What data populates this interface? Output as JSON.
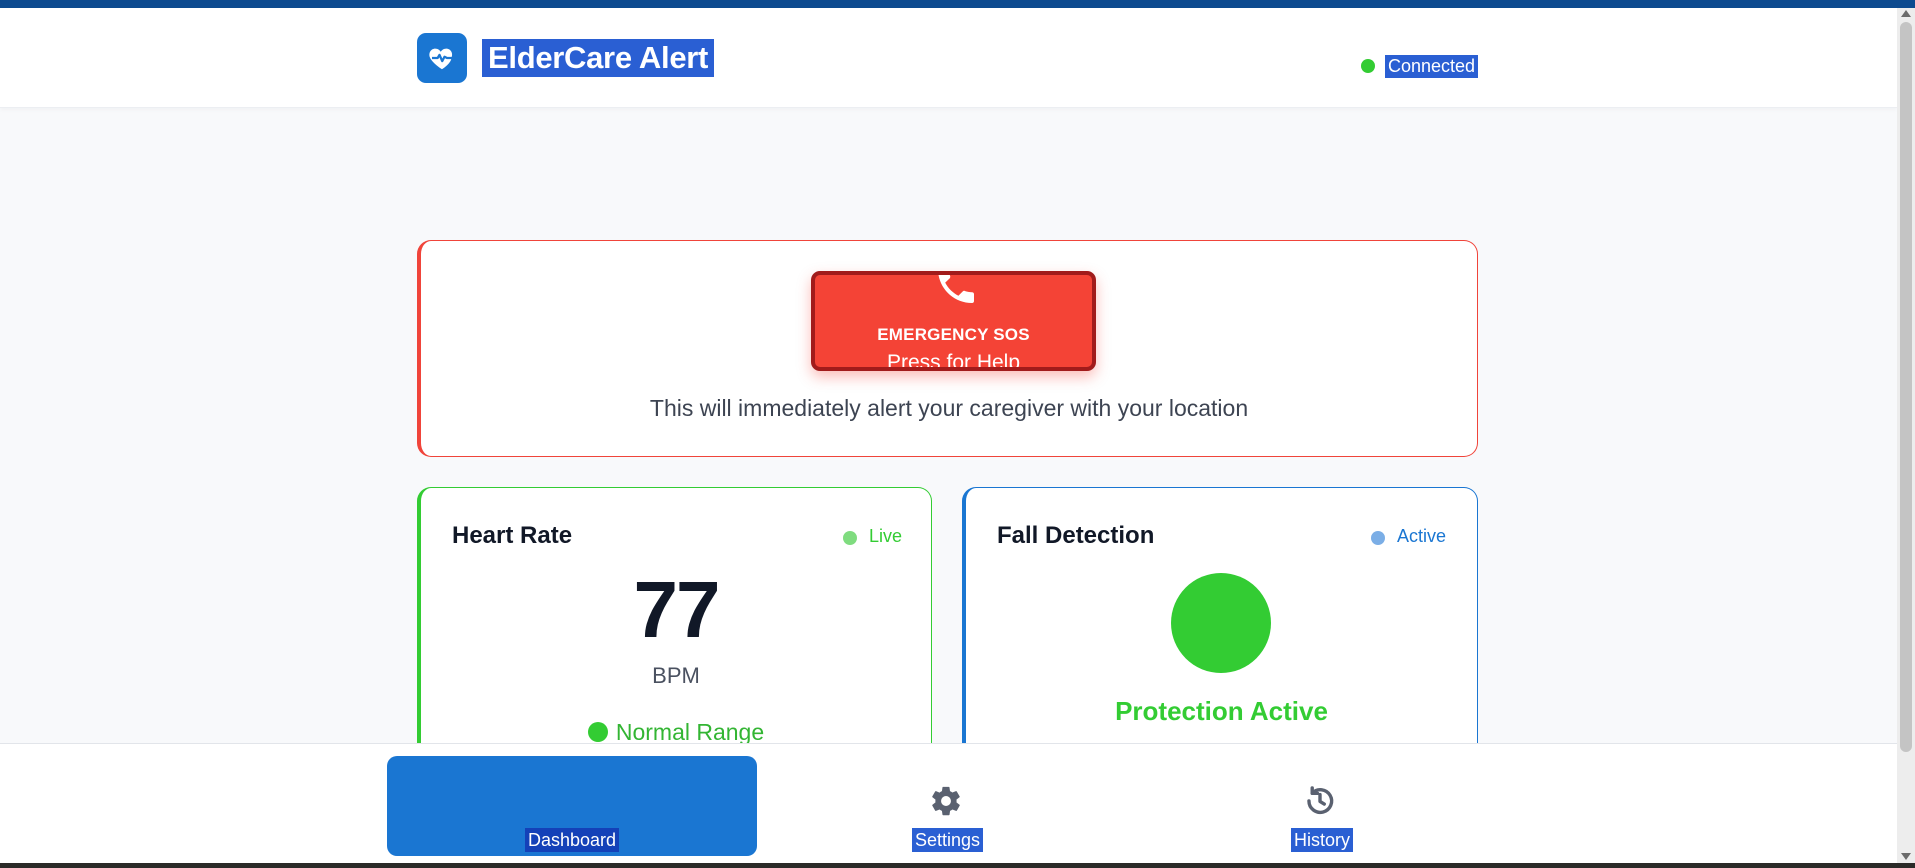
{
  "header": {
    "brand": "ElderCare Alert",
    "logo_icon": "heart-pulse-icon",
    "connection_status": "Connected",
    "connection_color": "#33cc33"
  },
  "sos": {
    "icon": "phone-icon",
    "label": "EMERGENCY SOS",
    "sublabel": "Press for Help",
    "description": "This will immediately alert your caregiver with your location",
    "color": "#f44336"
  },
  "heart_rate": {
    "title": "Heart Rate",
    "status": "Live",
    "value": "77",
    "unit": "BPM",
    "range": "Normal Range",
    "accent": "#33cc33"
  },
  "fall_detection": {
    "title": "Fall Detection",
    "status": "Active",
    "message": "Protection Active",
    "accent": "#1a76d2"
  },
  "nav": {
    "items": [
      {
        "label": "Dashboard",
        "icon": "dashboard-icon",
        "active": true
      },
      {
        "label": "Settings",
        "icon": "gear-icon",
        "active": false
      },
      {
        "label": "History",
        "icon": "history-icon",
        "active": false
      }
    ]
  }
}
